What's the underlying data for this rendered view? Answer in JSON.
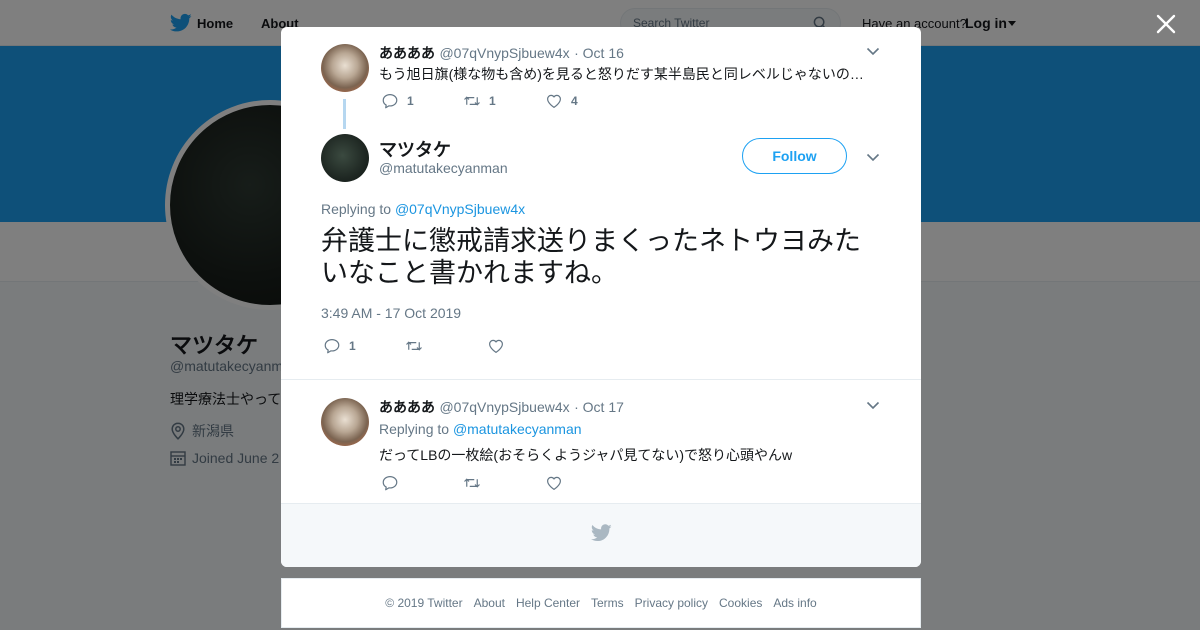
{
  "topbar": {
    "home": "Home",
    "about": "About",
    "search_placeholder": "Search Twitter",
    "have_account": "Have an account?",
    "login": "Log in"
  },
  "profile": {
    "name": "マツタケ",
    "handle": "@matutakecyanm",
    "bio": "理学療法士やって",
    "location": "新潟県",
    "joined": "Joined June 2"
  },
  "modal": {
    "parent_tweet": {
      "name": "ああああ",
      "handle": "@07qVnypSjbuew4x",
      "date": "· Oct 16",
      "text": "もう旭日旗(様な物も含め)を見ると怒りだす某半島民と同レベルじゃないの…",
      "replies": "1",
      "retweets": "1",
      "likes": "4"
    },
    "main_tweet": {
      "name": "マツタケ",
      "handle": "@matutakecyanman",
      "follow_label": "Follow",
      "replying_to_label": "Replying to",
      "replying_to_handle": "@07qVnypSjbuew4x",
      "text": "弁護士に懲戒請求送りまくったネトウヨみたいなこと書かれますね。",
      "timestamp": "3:49 AM - 17 Oct 2019",
      "replies": "1"
    },
    "reply_tweet": {
      "name": "ああああ",
      "handle": "@07qVnypSjbuew4x",
      "date": "· Oct 17",
      "replying_to_label": "Replying to",
      "replying_to_handle": "@matutakecyanman",
      "text": "だってLBの一枚絵(おそらくようジャパ見てない)で怒り心頭やんw"
    }
  },
  "footer": {
    "copyright": "© 2019 Twitter",
    "about": "About",
    "help": "Help Center",
    "terms": "Terms",
    "privacy": "Privacy policy",
    "cookies": "Cookies",
    "ads": "Ads info"
  },
  "colors": {
    "brand_blue": "#1da1f2",
    "link_blue": "#1b95e0",
    "secondary_text": "#657786"
  }
}
